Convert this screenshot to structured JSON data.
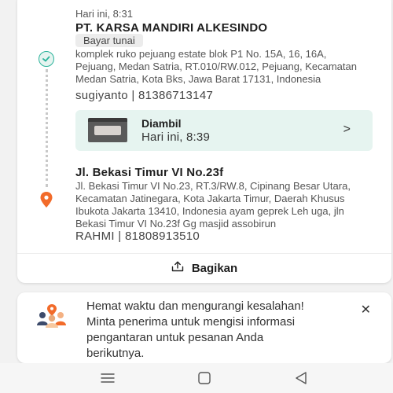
{
  "sender": {
    "time": "Hari ini, 8:31",
    "name": "PT. KARSA MANDIRI ALKESINDO",
    "payment_badge": "Bayar tunai",
    "address": "komplek ruko pejuang estate blok P1 No. 15A, 16, 16A, Pejuang, Medan Satria, RT.010/RW.012, Pejuang, Kecamatan Medan Satria, Kota Bks, Jawa Barat 17131, Indonesia",
    "contact": "sugiyanto | 81386713147"
  },
  "pickup": {
    "status": "Diambil",
    "time": "Hari ini, 8:39",
    "chevron": ">"
  },
  "recipient": {
    "name": "Jl. Bekasi Timur VI No.23f",
    "address": "Jl. Bekasi Timur VI No.23, RT.3/RW.8, Cipinang Besar Utara, Kecamatan Jatinegara, Kota Jakarta Timur, Daerah Khusus Ibukota Jakarta 13410, Indonesia ayam geprek Leh uga, jln Bekasi Timur VI No.23f Gg masjid assobirun",
    "contact": "RAHMI | 81808913510"
  },
  "share": {
    "label": "Bagikan",
    "icon": "share-icon"
  },
  "tip": {
    "text": "Hemat waktu dan mengurangi kesalahan! Minta penerima untuk mengisi informasi pengantaran untuk pesanan Anda berikutnya.",
    "close": "✕",
    "icon": "people-pin-icon"
  },
  "colors": {
    "accent": "#2bb39b",
    "pin": "#f26b2a",
    "pickup_bg": "#e6f4f0"
  },
  "navbar": {
    "icons": [
      "menu-icon",
      "home-icon",
      "back-icon"
    ]
  }
}
